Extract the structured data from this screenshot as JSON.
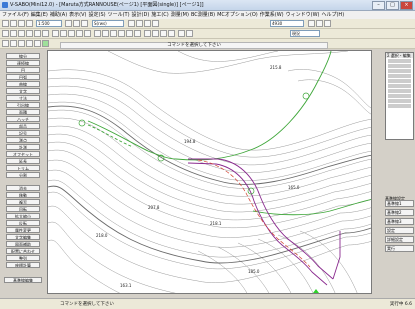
{
  "window": {
    "title": "V-SABO(Mini12.0) - [Maruta方式RANNOUSE(ページ1) [平面図(single)] [ページ1]]"
  },
  "menu": [
    "ファイル(F)",
    "編集(E)",
    "補助(A)",
    "表示(V)",
    "設定(S)",
    "ツール(T)",
    "設計(D)",
    "施工(C)",
    "測量(M)",
    "BC測量(B)",
    "MCオプション(O)",
    "作業系(W)",
    "ウィンドウ(W)",
    "ヘルプ(H)"
  ],
  "toolbar": {
    "scale_combo": "1:500",
    "layer_combo": "S(rws)",
    "pen_combo": "4930",
    "units_combo": "現況"
  },
  "command_prompt": "コマンドを選択して下さい",
  "left_panel": {
    "group1": [
      "線分",
      "連続線",
      "円",
      "円弧",
      "曲線",
      "文字",
      "寸法",
      "引出線",
      "面積",
      "ハッチ",
      "部品",
      "記号",
      "測点",
      "計測",
      "オフセット",
      "延長",
      "トリム",
      "分割"
    ],
    "group2": [
      "消去",
      "移動",
      "複写",
      "回転",
      "拡大縮小",
      "反転",
      "属性変更",
      "文字編集",
      "図面補助",
      "配置に合わせ",
      "整列",
      "座標計算"
    ],
    "bottom_button": "基準線編集"
  },
  "map": {
    "labels": [
      "215.8",
      "194.8",
      "165.0",
      "207.8",
      "218.0",
      "185.0",
      "218.1",
      "163.1"
    ]
  },
  "right_panel": {
    "header": "Σ 選択・編集",
    "section_label": "基準線設定",
    "buttons": [
      "基準線1",
      "基準線2",
      "基準線3",
      "設定",
      "詳細設定",
      "実行"
    ]
  },
  "status": {
    "message": "コマンドを選択して下さい",
    "right": "実行中  6.6"
  }
}
